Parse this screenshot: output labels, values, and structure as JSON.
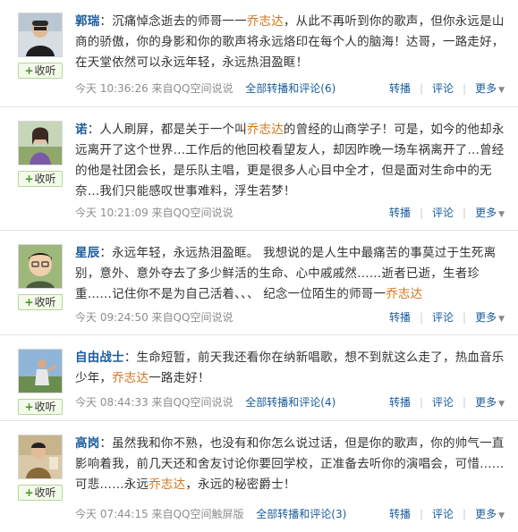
{
  "posts": [
    {
      "author": "郭瑞",
      "follow_label": "收听",
      "segments": [
        "：沉痛悼念逝去的师哥一一",
        "乔志达",
        "，从此不再听到你的歌声，但你永远是山商的骄傲，你的身影和你的歌声将永远烙印在每个人的脑海！达哥，一路走好，在天堂依然可以永远年轻，永远热泪盈眶！"
      ],
      "time": "今天 10:36:26",
      "source": "来自QQ空间说说",
      "forward_comment_label": "全部转播和评论",
      "forward_comment_count": "(6)",
      "actions": {
        "forward": "转播",
        "comment": "评论",
        "more": "更多"
      }
    },
    {
      "author": "诺",
      "follow_label": "收听",
      "segments": [
        "：人人刷屏，都是关于一个叫",
        "乔志达",
        "的曾经的山商学子！可是，如今的他却永远离开了这个世界…工作后的他回校看望友人，却因昨晚一场车祸离开了…曾经的他是社团会长，是乐队主唱，更是很多人心目中全才，但是面对生命中的无奈…我们只能感叹世事难料，浮生若梦！"
      ],
      "time": "今天 10:21:09",
      "source": "来自QQ空间说说",
      "forward_comment_label": "",
      "forward_comment_count": "",
      "actions": {
        "forward": "转播",
        "comment": "评论",
        "more": "更多"
      }
    },
    {
      "author": "星辰",
      "follow_label": "收听",
      "segments": [
        "：永远年轻，永远热泪盈眶。 我想说的是人生中最痛苦的事莫过于生死离别，意外、意外夺去了多少鲜活的生命、心中戚戚然……逝者已逝，生者珍重……记住你不是为自己活着、、、 纪念一位陌生的师哥一",
        "乔志达",
        ""
      ],
      "time": "今天 09:24:50",
      "source": "来自QQ空间说说",
      "forward_comment_label": "",
      "forward_comment_count": "",
      "actions": {
        "forward": "转播",
        "comment": "评论",
        "more": "更多"
      }
    },
    {
      "author": "自由战士",
      "follow_label": "收听",
      "segments": [
        "：生命短暂，前天我还看你在纳新唱歌，想不到就这么走了，热血音乐少年，",
        "乔志达",
        "一路走好！"
      ],
      "time": "今天 08:44:33",
      "source": "来自QQ空间说说",
      "forward_comment_label": "全部转播和评论",
      "forward_comment_count": "(4)",
      "actions": {
        "forward": "转播",
        "comment": "评论",
        "more": "更多"
      }
    },
    {
      "author": "高岗",
      "follow_label": "收听",
      "segments": [
        "：虽然我和你不熟，也没有和你怎么说过话，但是你的歌声，你的帅气一直影响着我，前几天还和舍友讨论你要回学校，正准备去听你的演唱会，可惜……可悲……永远",
        "乔志达",
        "，永远的秘密爵士！"
      ],
      "time": "今天 07:44:15",
      "source": "来自QQ空间触屏版",
      "forward_comment_label": "全部转播和评论",
      "forward_comment_count": "(3)",
      "actions": {
        "forward": "转播",
        "comment": "评论",
        "more": "更多"
      }
    }
  ],
  "colors": {
    "author": "#1a5c9c",
    "keyword": "#d2751c",
    "text": "#333333",
    "meta": "#8e8e8e",
    "follow_plus": "#3a9a1a"
  }
}
